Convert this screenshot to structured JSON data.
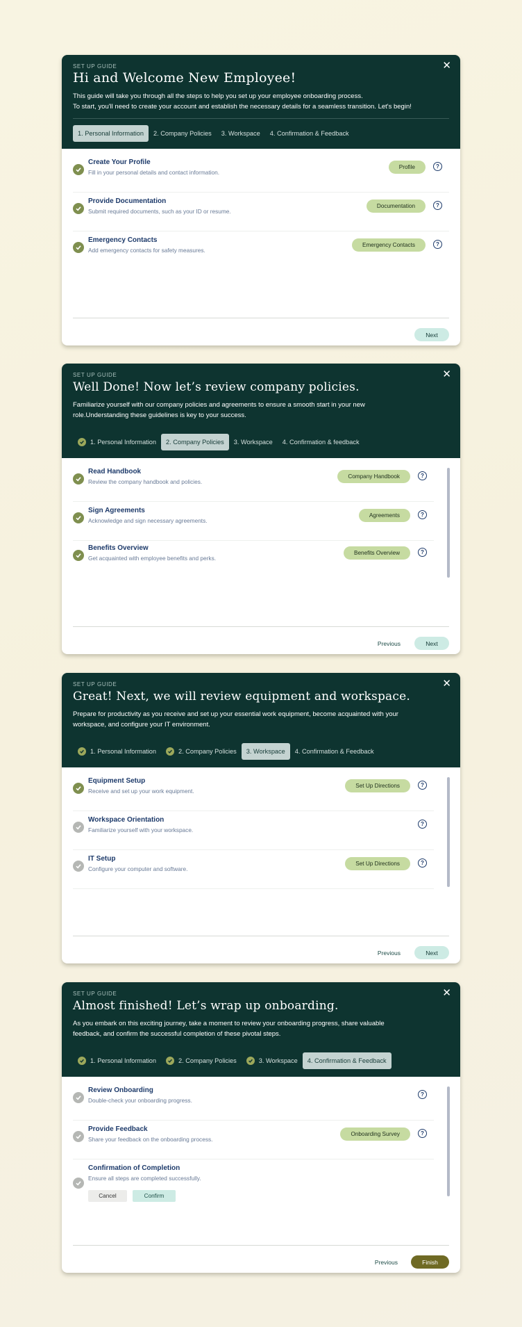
{
  "common": {
    "guide_label": "SET UP GUIDE",
    "next": "Next",
    "previous": "Previous",
    "finish": "Finish"
  },
  "cards": [
    {
      "title": "Hi and Welcome New Employee!",
      "desc": [
        "This guide will take you through all the steps to help you set up your employee onboarding process.",
        "To start, you'll need to create your account and establish the necessary details for a seamless transition. Let's begin!"
      ],
      "tabs": [
        "1. Personal Information",
        "2. Company Policies",
        "3. Workspace",
        "4. Confirmation & Feedback"
      ],
      "steps": [
        {
          "title": "Create Your Profile",
          "desc": "Fill in your personal details and contact information.",
          "button": "Profile"
        },
        {
          "title": "Provide Documentation",
          "desc": "Submit required documents, such as your ID or resume.",
          "button": "Documentation"
        },
        {
          "title": "Emergency Contacts",
          "desc": "Add emergency contacts for safety measures.",
          "button": "Emergency Contacts"
        }
      ]
    },
    {
      "title": "Well Done! Now let’s review company policies.",
      "desc": [
        "Familiarize yourself with our company policies and agreements to ensure a smooth start in your new",
        "role.Understanding these guidelines is key to your success."
      ],
      "tabs": [
        "1. Personal Information",
        "2. Company Policies",
        "3. Workspace",
        "4. Confirmation & feedback"
      ],
      "steps": [
        {
          "title": "Read Handbook",
          "desc": "Review the company handbook and policies.",
          "button": "Company Handbook"
        },
        {
          "title": "Sign Agreements",
          "desc": "Acknowledge and sign necessary agreements.",
          "button": "Agreements"
        },
        {
          "title": "Benefits Overview",
          "desc": "Get acquainted with employee benefits and perks.",
          "button": "Benefits Overview"
        }
      ]
    },
    {
      "title": "Great! Next, we will review equipment and workspace.",
      "desc": [
        "Prepare for productivity as you receive and set up your essential work equipment, become acquainted with your",
        "workspace, and configure your IT environment."
      ],
      "tabs": [
        "1. Personal Information",
        "2. Company Policies",
        "3. Workspace",
        "4. Confirmation & Feedback"
      ],
      "steps": [
        {
          "title": "Equipment Setup",
          "desc": "Receive and set up your work equipment.",
          "button": "Set Up Directions"
        },
        {
          "title": "Workspace Orientation",
          "desc": "Familiarize yourself with your workspace.",
          "button": ""
        },
        {
          "title": "IT Setup",
          "desc": "Configure your computer and software.",
          "button": "Set Up Directions"
        }
      ]
    },
    {
      "title": "Almost finished! Let’s wrap up onboarding.",
      "desc": [
        "As you embark on this exciting journey, take a moment to review your onboarding progress, share valuable",
        "feedback, and confirm the successful completion of these pivotal steps."
      ],
      "tabs": [
        "1. Personal Information",
        "2. Company Policies",
        "3. Workspace",
        "4. Confirmation & Feedback"
      ],
      "steps": [
        {
          "title": "Review Onboarding",
          "desc": "Double-check your onboarding progress.",
          "button": ""
        },
        {
          "title": "Provide Feedback",
          "desc": "Share your feedback on the onboarding process.",
          "button": "Onboarding Survey"
        },
        {
          "title": "Confirmation of Completion",
          "desc": "Ensure all steps are completed successfully.",
          "button": ""
        }
      ],
      "cancel": "Cancel",
      "confirm": "Confirm"
    }
  ],
  "colors": {
    "header": "#0e3430",
    "pill": "#c6dba1",
    "check_done": "#7f8f4f",
    "check_pending": "#b5b7b4",
    "finish": "#6f6a24"
  }
}
